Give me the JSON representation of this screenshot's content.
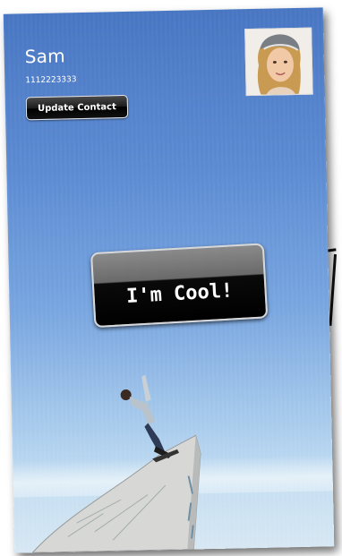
{
  "contact": {
    "name": "Sam",
    "phone": "1112223333",
    "update_label": "Update Contact"
  },
  "main_button": {
    "label": "I'm Cool!"
  },
  "colors": {
    "sky_top": "#4b78c3",
    "sky_bottom": "#d8e8f3",
    "button_bg": "#000000",
    "text": "#ffffff"
  },
  "icons": {
    "avatar": "contact-photo",
    "background": "skateboarder-photo"
  }
}
